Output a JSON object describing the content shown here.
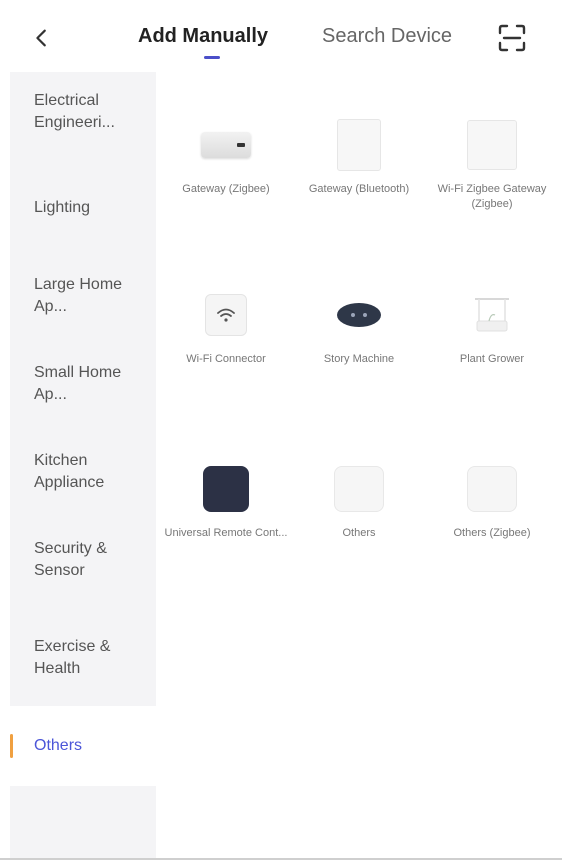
{
  "header": {
    "back_icon": "chevron-left-icon",
    "tabs": [
      {
        "label": "Add Manually",
        "active": true
      },
      {
        "label": "Search Device",
        "active": false
      }
    ],
    "scan_icon": "scan-icon",
    "accent_color": "#4b4fc9"
  },
  "sidebar": {
    "items": [
      {
        "label": "Electrical Engineeri..."
      },
      {
        "label": "Lighting"
      },
      {
        "label": "Large Home Ap..."
      },
      {
        "label": "Small Home Ap..."
      },
      {
        "label": "Kitchen Appliance"
      },
      {
        "label": "Security & Sensor"
      },
      {
        "label": "Exercise & Health"
      },
      {
        "label": "Others",
        "active": true
      }
    ],
    "active_color": "#4b55d8",
    "active_bar_color": "#f0a040"
  },
  "devices": [
    {
      "label": "Gateway (Zigbee)",
      "icon": "gateway-zigbee-icon"
    },
    {
      "label": "Gateway (Bluetooth)",
      "icon": "gateway-bluetooth-icon"
    },
    {
      "label": "Wi-Fi Zigbee Gateway (Zigbee)",
      "icon": "wifi-zigbee-gateway-icon"
    },
    {
      "label": "Wi-Fi Connector",
      "icon": "wifi-connector-icon"
    },
    {
      "label": "Story Machine",
      "icon": "story-machine-icon"
    },
    {
      "label": "Plant Grower",
      "icon": "plant-grower-icon"
    },
    {
      "label": "Universal Remote Cont...",
      "icon": "universal-remote-icon"
    },
    {
      "label": "Others",
      "icon": "others-device-icon"
    },
    {
      "label": "Others (Zigbee)",
      "icon": "others-zigbee-icon"
    }
  ]
}
